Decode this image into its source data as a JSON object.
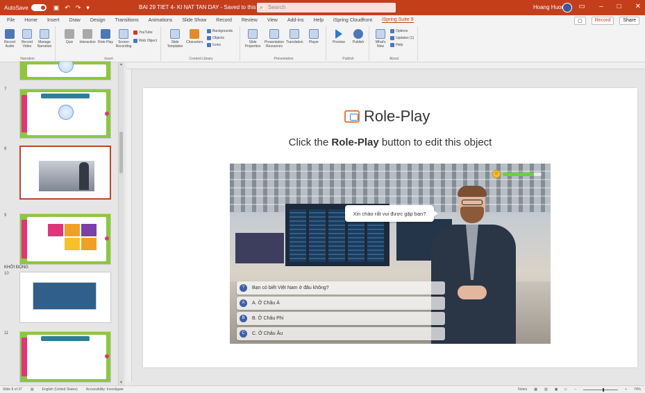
{
  "titlebar": {
    "autosave": "AutoSave",
    "doc_title": "BAI 29 TIET 4- KI NAT TAN DAY - Saved to this PC",
    "search_placeholder": "Search",
    "user": "Hoang Huong"
  },
  "tabs": [
    "File",
    "Home",
    "Insert",
    "Draw",
    "Design",
    "Transitions",
    "Animations",
    "Slide Show",
    "Record",
    "Review",
    "View",
    "Add-ins",
    "Help",
    "iSpring Cloudfront",
    "iSpring Suite 9"
  ],
  "active_tab": "iSpring Suite 9",
  "tabs_right": {
    "record": "Record",
    "share": "Share"
  },
  "ribbon": {
    "groups": [
      {
        "label": "Narration"
      },
      {
        "label": "Insert"
      },
      {
        "label": "Content Library"
      },
      {
        "label": "Presentation"
      },
      {
        "label": "Publish"
      },
      {
        "label": "About"
      }
    ],
    "buttons": {
      "record_audio": "Record Audio",
      "record_video": "Record Video",
      "manage_narration": "Manage Narration",
      "quiz": "Quiz",
      "interaction": "Interaction",
      "role_play": "Role-Play",
      "screen_recording": "Screen Recording",
      "youtube": "YouTube",
      "web_object": "Web Object",
      "slide_templates": "Slide Templates",
      "characters": "Characters",
      "backgrounds": "Backgrounds",
      "objects": "Objects",
      "icons": "Icons",
      "slide_properties": "Slide Properties",
      "presentation_resources": "Presentation Resources",
      "translation": "Translation",
      "player": "Player",
      "preview": "Preview",
      "publish": "Publish",
      "whats_new": "What's New",
      "options": "Options",
      "updates": "Updates (1)",
      "help": "Help"
    }
  },
  "slides_panel": {
    "section": "KHỞI ĐỘNG",
    "numbers": [
      "7",
      "8",
      "9",
      "10",
      "11"
    ]
  },
  "slide": {
    "title": "Role-Play",
    "subtitle_pre": "Click the ",
    "subtitle_bold": "Role-Play",
    "subtitle_post": " button to edit this object",
    "speech": "Xin chào rất vui được gặp bạn?",
    "question": "Bạn có biết Việt Nam ở đâu không?",
    "options": [
      {
        "badge": "A",
        "text": "A. Ở Châu Á"
      },
      {
        "badge": "B",
        "text": "B. Ở Châu Phi"
      },
      {
        "badge": "C",
        "text": "C. Ở Châu Âu"
      }
    ],
    "mood_level": 0.8,
    "colors": {
      "accent": "#c43e1c",
      "option_badge": "#3d5fa8",
      "meter_fill": "#6ccf3c"
    }
  },
  "statusbar": {
    "slide_info": "Slide 8 of 37",
    "language": "English (United States)",
    "accessibility": "Accessibility: Investigate",
    "notes": "Notes",
    "zoom": "74%"
  }
}
